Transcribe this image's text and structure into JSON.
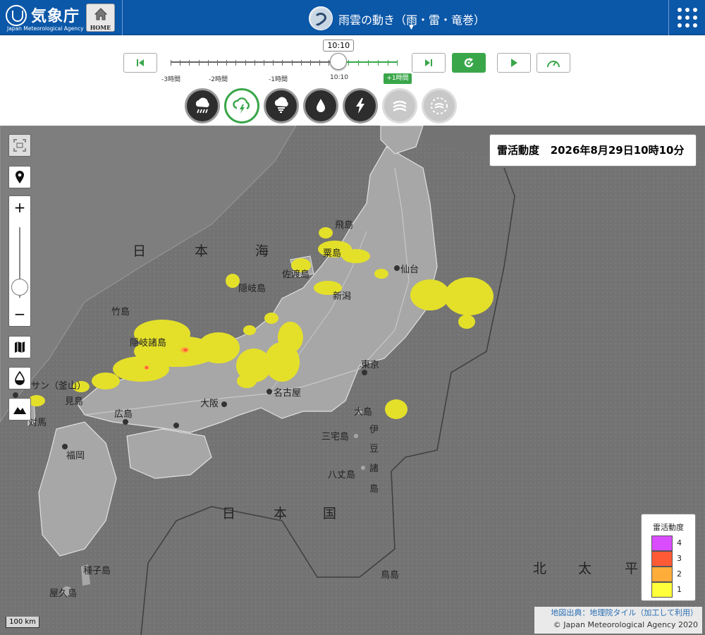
{
  "header": {
    "logo_jp": "気象庁",
    "logo_en": "Japan Meteorological Agency",
    "home_label": "HOME",
    "title": "雨雲の動き（雨・雷・竜巻）",
    "title_caret": "▼",
    "brand_color": "#0b57a8"
  },
  "time_controls": {
    "current_time": "10:10",
    "tick_labels": [
      "-3時間",
      "-2時間",
      "-1時間",
      "10:10"
    ],
    "future_label": "+1時間",
    "buttons": [
      "skip-to-start",
      "skip-to-end",
      "reload",
      "play",
      "speed"
    ],
    "position_fraction": 0.74
  },
  "modes": [
    {
      "name": "rain",
      "icon": "rain-cloud-icon",
      "state": "normal"
    },
    {
      "name": "thunder",
      "icon": "thunder-cloud-icon",
      "state": "active"
    },
    {
      "name": "tornado",
      "icon": "tornado-cloud-icon",
      "state": "normal"
    },
    {
      "name": "precipitation",
      "icon": "water-drop-icon",
      "state": "normal"
    },
    {
      "name": "lightning",
      "icon": "lightning-bolt-icon",
      "state": "normal"
    },
    {
      "name": "cloud-1",
      "icon": "cloud-layer-icon",
      "state": "disabled"
    },
    {
      "name": "cloud-2",
      "icon": "cloud-dashed-icon",
      "state": "disabled"
    }
  ],
  "map": {
    "info_title": "雷活動度",
    "info_datetime": "2026年8月29日10時10分",
    "zoom_level_fraction": 0.15,
    "scale_label": "100 km",
    "labels": {
      "sea_japan": [
        "日",
        "本",
        "海"
      ],
      "pacific_south": [
        "日",
        "本",
        "国"
      ],
      "north_pacific": [
        "北",
        "太",
        "平"
      ],
      "izu": [
        "伊",
        "豆",
        "諸",
        "島"
      ],
      "places": [
        "飛島",
        "粟島",
        "佐渡島",
        "新潟",
        "仙台",
        "隠岐島",
        "竹島",
        "隠岐諸島",
        "東京",
        "名古屋",
        "大阪",
        "広島",
        "福岡",
        "見島",
        "対馬",
        "サン（釜山）",
        "大島",
        "三宅島",
        "八丈島",
        "種子島",
        "屋久島",
        "鳥島"
      ]
    }
  },
  "legend": {
    "title": "雷活動度",
    "levels": [
      {
        "value": "4",
        "color": "#d94dff"
      },
      {
        "value": "3",
        "color": "#ff5a36"
      },
      {
        "value": "2",
        "color": "#ffad3a"
      },
      {
        "value": "1",
        "color": "#ffff3a"
      }
    ]
  },
  "attribution": {
    "source": "地図出典：地理院タイル（加工して利用）",
    "copyright": "© Japan Meteorological Agency 2020"
  }
}
